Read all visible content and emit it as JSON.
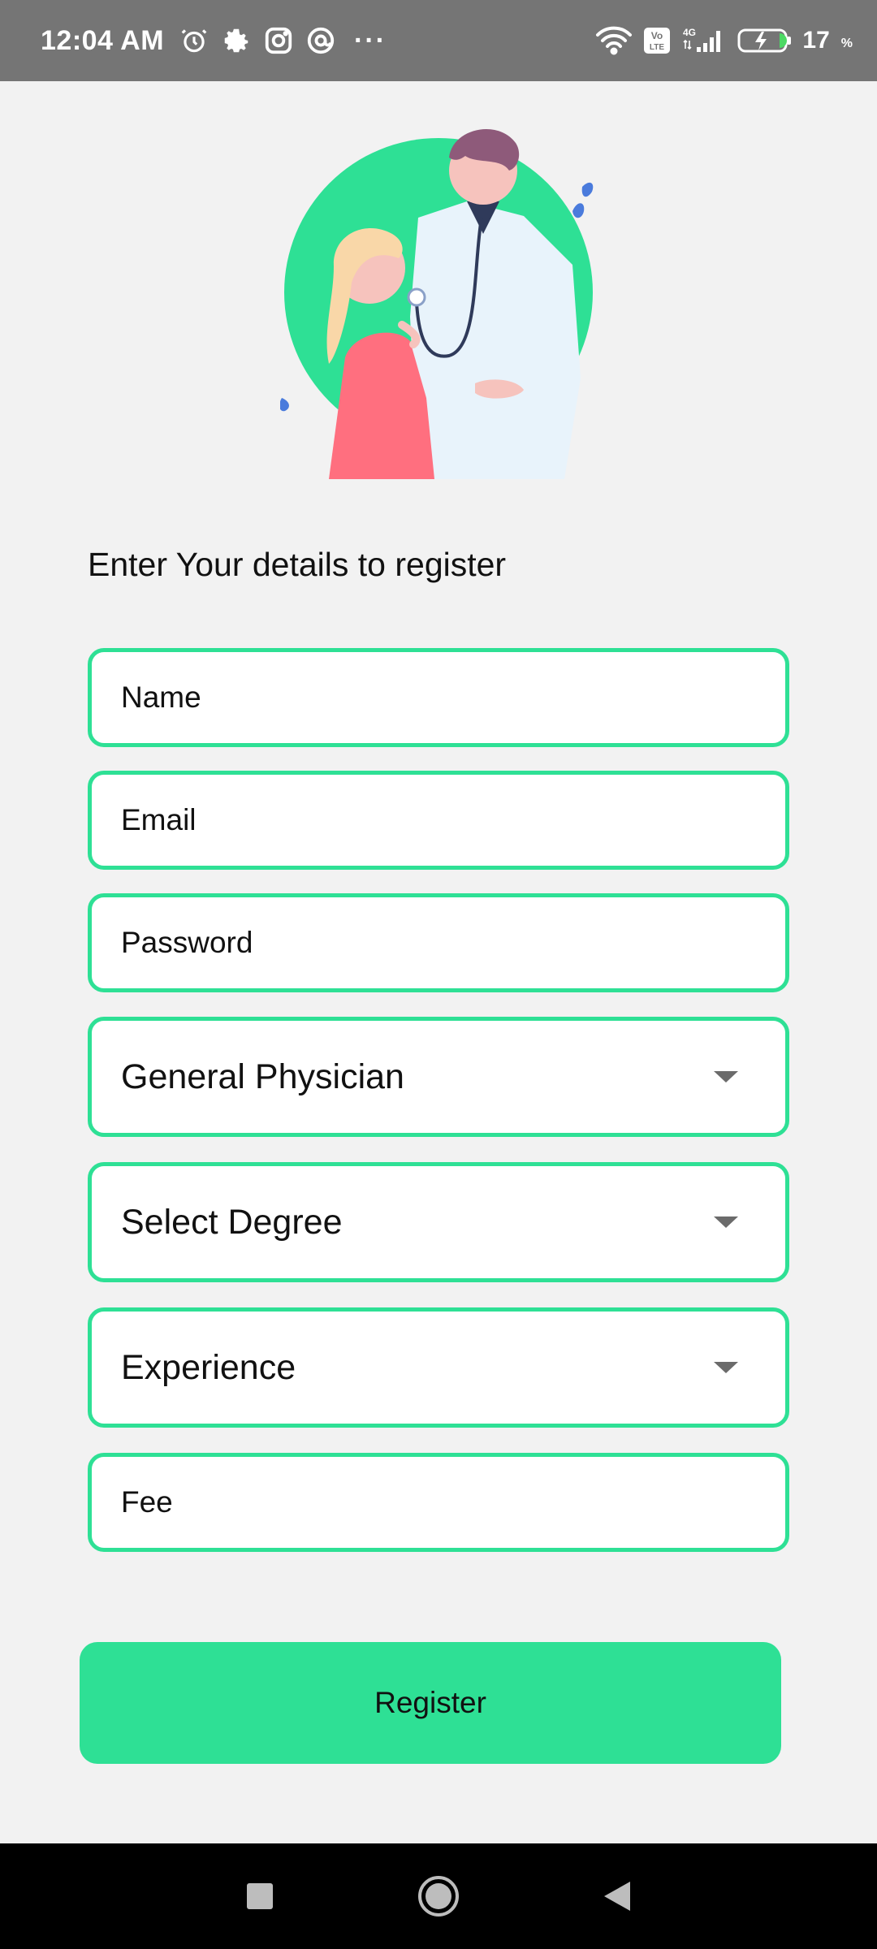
{
  "status_bar": {
    "time": "12:04 AM",
    "left_icons": [
      "alarm-icon",
      "settings-gear-icon",
      "instagram-icon",
      "at-sign-icon"
    ],
    "more": "···",
    "right_icons": [
      "wifi-icon",
      "volte-icon",
      "signal-4g-icon",
      "battery-charging-icon"
    ],
    "network_label": "4G",
    "volte_label": "Vo LTE",
    "battery_level": "17",
    "battery_unit": "%"
  },
  "illustration": {
    "name": "doctor-patient-illustration",
    "accent_color": "#2ee095"
  },
  "form": {
    "heading": "Enter Your details to register",
    "name_placeholder": "Name",
    "email_placeholder": "Email",
    "password_placeholder": "Password",
    "specialty_value": "General Physician",
    "degree_value": "Select Degree",
    "experience_value": "Experience",
    "fee_placeholder": "Fee",
    "register_label": "Register"
  },
  "nav_bar": {
    "buttons": [
      "recents-square-icon",
      "home-circle-icon",
      "back-triangle-icon"
    ]
  },
  "colors": {
    "accent": "#2ee095",
    "background": "#f2f2f2",
    "status_bar": "#757575",
    "nav_bar": "#000000"
  }
}
